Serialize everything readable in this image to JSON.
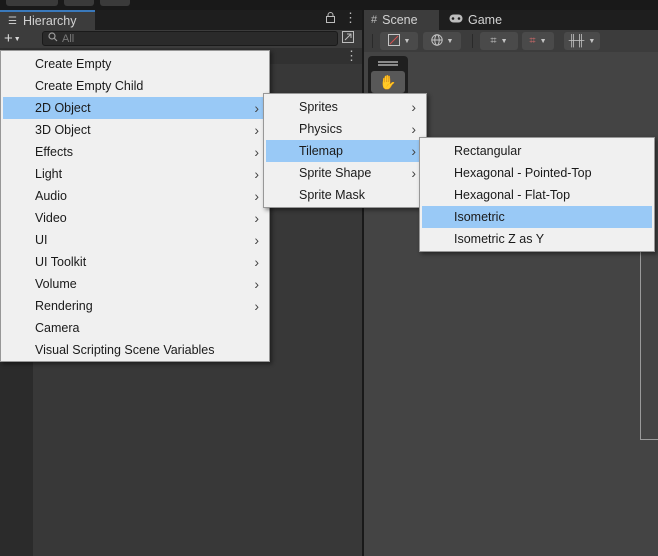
{
  "hierarchy": {
    "tab_label": "Hierarchy",
    "add_button": "+",
    "search_placeholder": "All"
  },
  "scene": {
    "tabs": [
      {
        "label": "Scene",
        "icon": "grid-icon"
      },
      {
        "label": "Game",
        "icon": "gamepad-icon"
      }
    ]
  },
  "menus": {
    "main": {
      "items": [
        {
          "label": "Create Empty",
          "submenu": false
        },
        {
          "label": "Create Empty Child",
          "submenu": false
        },
        {
          "label": "2D Object",
          "submenu": true,
          "highlighted": true
        },
        {
          "label": "3D Object",
          "submenu": true
        },
        {
          "label": "Effects",
          "submenu": true
        },
        {
          "label": "Light",
          "submenu": true
        },
        {
          "label": "Audio",
          "submenu": true
        },
        {
          "label": "Video",
          "submenu": true
        },
        {
          "label": "UI",
          "submenu": true
        },
        {
          "label": "UI Toolkit",
          "submenu": true
        },
        {
          "label": "Volume",
          "submenu": true
        },
        {
          "label": "Rendering",
          "submenu": true
        },
        {
          "label": "Camera",
          "submenu": false
        },
        {
          "label": "Visual Scripting Scene Variables",
          "submenu": false
        }
      ]
    },
    "object_2d": {
      "items": [
        {
          "label": "Sprites",
          "submenu": true
        },
        {
          "label": "Physics",
          "submenu": true
        },
        {
          "label": "Tilemap",
          "submenu": true,
          "highlighted": true
        },
        {
          "label": "Sprite Shape",
          "submenu": true
        },
        {
          "label": "Sprite Mask",
          "submenu": false
        }
      ]
    },
    "tilemap": {
      "items": [
        {
          "label": "Rectangular"
        },
        {
          "label": "Hexagonal - Pointed-Top"
        },
        {
          "label": "Hexagonal - Flat-Top"
        },
        {
          "label": "Isometric",
          "highlighted": true
        },
        {
          "label": "Isometric Z as Y"
        }
      ]
    },
    "highlight_color": "#99c9f6"
  }
}
